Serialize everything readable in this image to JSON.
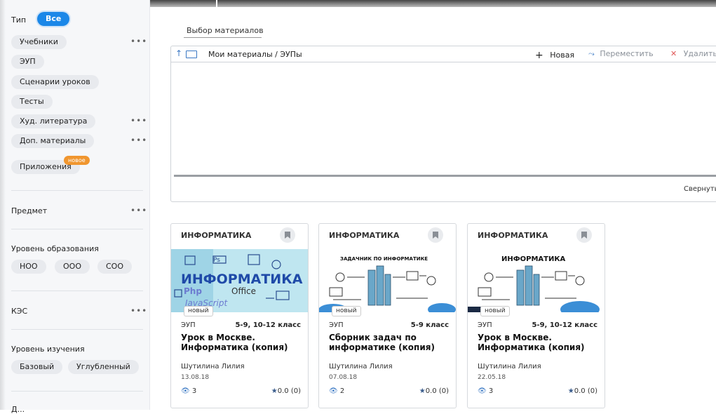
{
  "sidebar": {
    "type_label": "Тип",
    "all_chip": "Все",
    "types": [
      "Учебники",
      "ЭУП",
      "Сценарии уроков",
      "Тесты",
      "Худ. литература",
      "Доп. материалы",
      "Приложения"
    ],
    "new_badge": "новое",
    "subject_label": "Предмет",
    "edu_level_label": "Уровень образования",
    "edu_levels": [
      "НОО",
      "ООО",
      "СОО"
    ],
    "kes_label": "КЭС",
    "study_level_label": "Уровень изучения",
    "study_levels": [
      "Базовый",
      "Углубленный"
    ],
    "cut_label": "Д..."
  },
  "main": {
    "tab_title": "Выбор материалов",
    "breadcrumb": "Мои материалы  /  ЭУПы",
    "actions": {
      "new": "Новая",
      "move": "Переместить",
      "delete": "Удалить"
    },
    "collapse": "Свернуть"
  },
  "cards": [
    {
      "subject": "ИНФОРМАТИКА",
      "tag": "новый",
      "type": "ЭУП",
      "grade": "5-9, 10-12 класс",
      "title": "Урок в Москве. Информатика (копия)",
      "author": "Шутилина Лилия",
      "date": "13.08.18",
      "views": "3",
      "rating": "0.0 (0)"
    },
    {
      "subject": "ИНФОРМАТИКА",
      "tag": "новый",
      "type": "ЭУП",
      "grade": "5-9 класс",
      "title": "Сборник задач по информатике (копия)",
      "author": "Шутилина Лилия",
      "date": "07.08.18",
      "views": "2",
      "rating": "0.0 (0)"
    },
    {
      "subject": "ИНФОРМАТИКА",
      "tag": "новый",
      "type": "ЭУП",
      "grade": "5-9, 10-12 класс",
      "title": "Урок в Москве. Информатика (копия)",
      "author": "Шутилина Лилия",
      "date": "22.05.18",
      "views": "3",
      "rating": "0.0 (0)"
    }
  ],
  "images": {
    "card1_text": "ИНФОРМАТИКА",
    "card1_words": [
      "Php",
      "Office",
      "JavaScript",
      "Ps"
    ],
    "card2_text": "ЗАДАЧНИК ПО ИНФОРМАТИКЕ",
    "card3_text": "ИНФОРМАТИКА"
  },
  "colors": {
    "accent": "#1a87e8",
    "badge": "#f0962f",
    "delete": "#e05a5a"
  }
}
